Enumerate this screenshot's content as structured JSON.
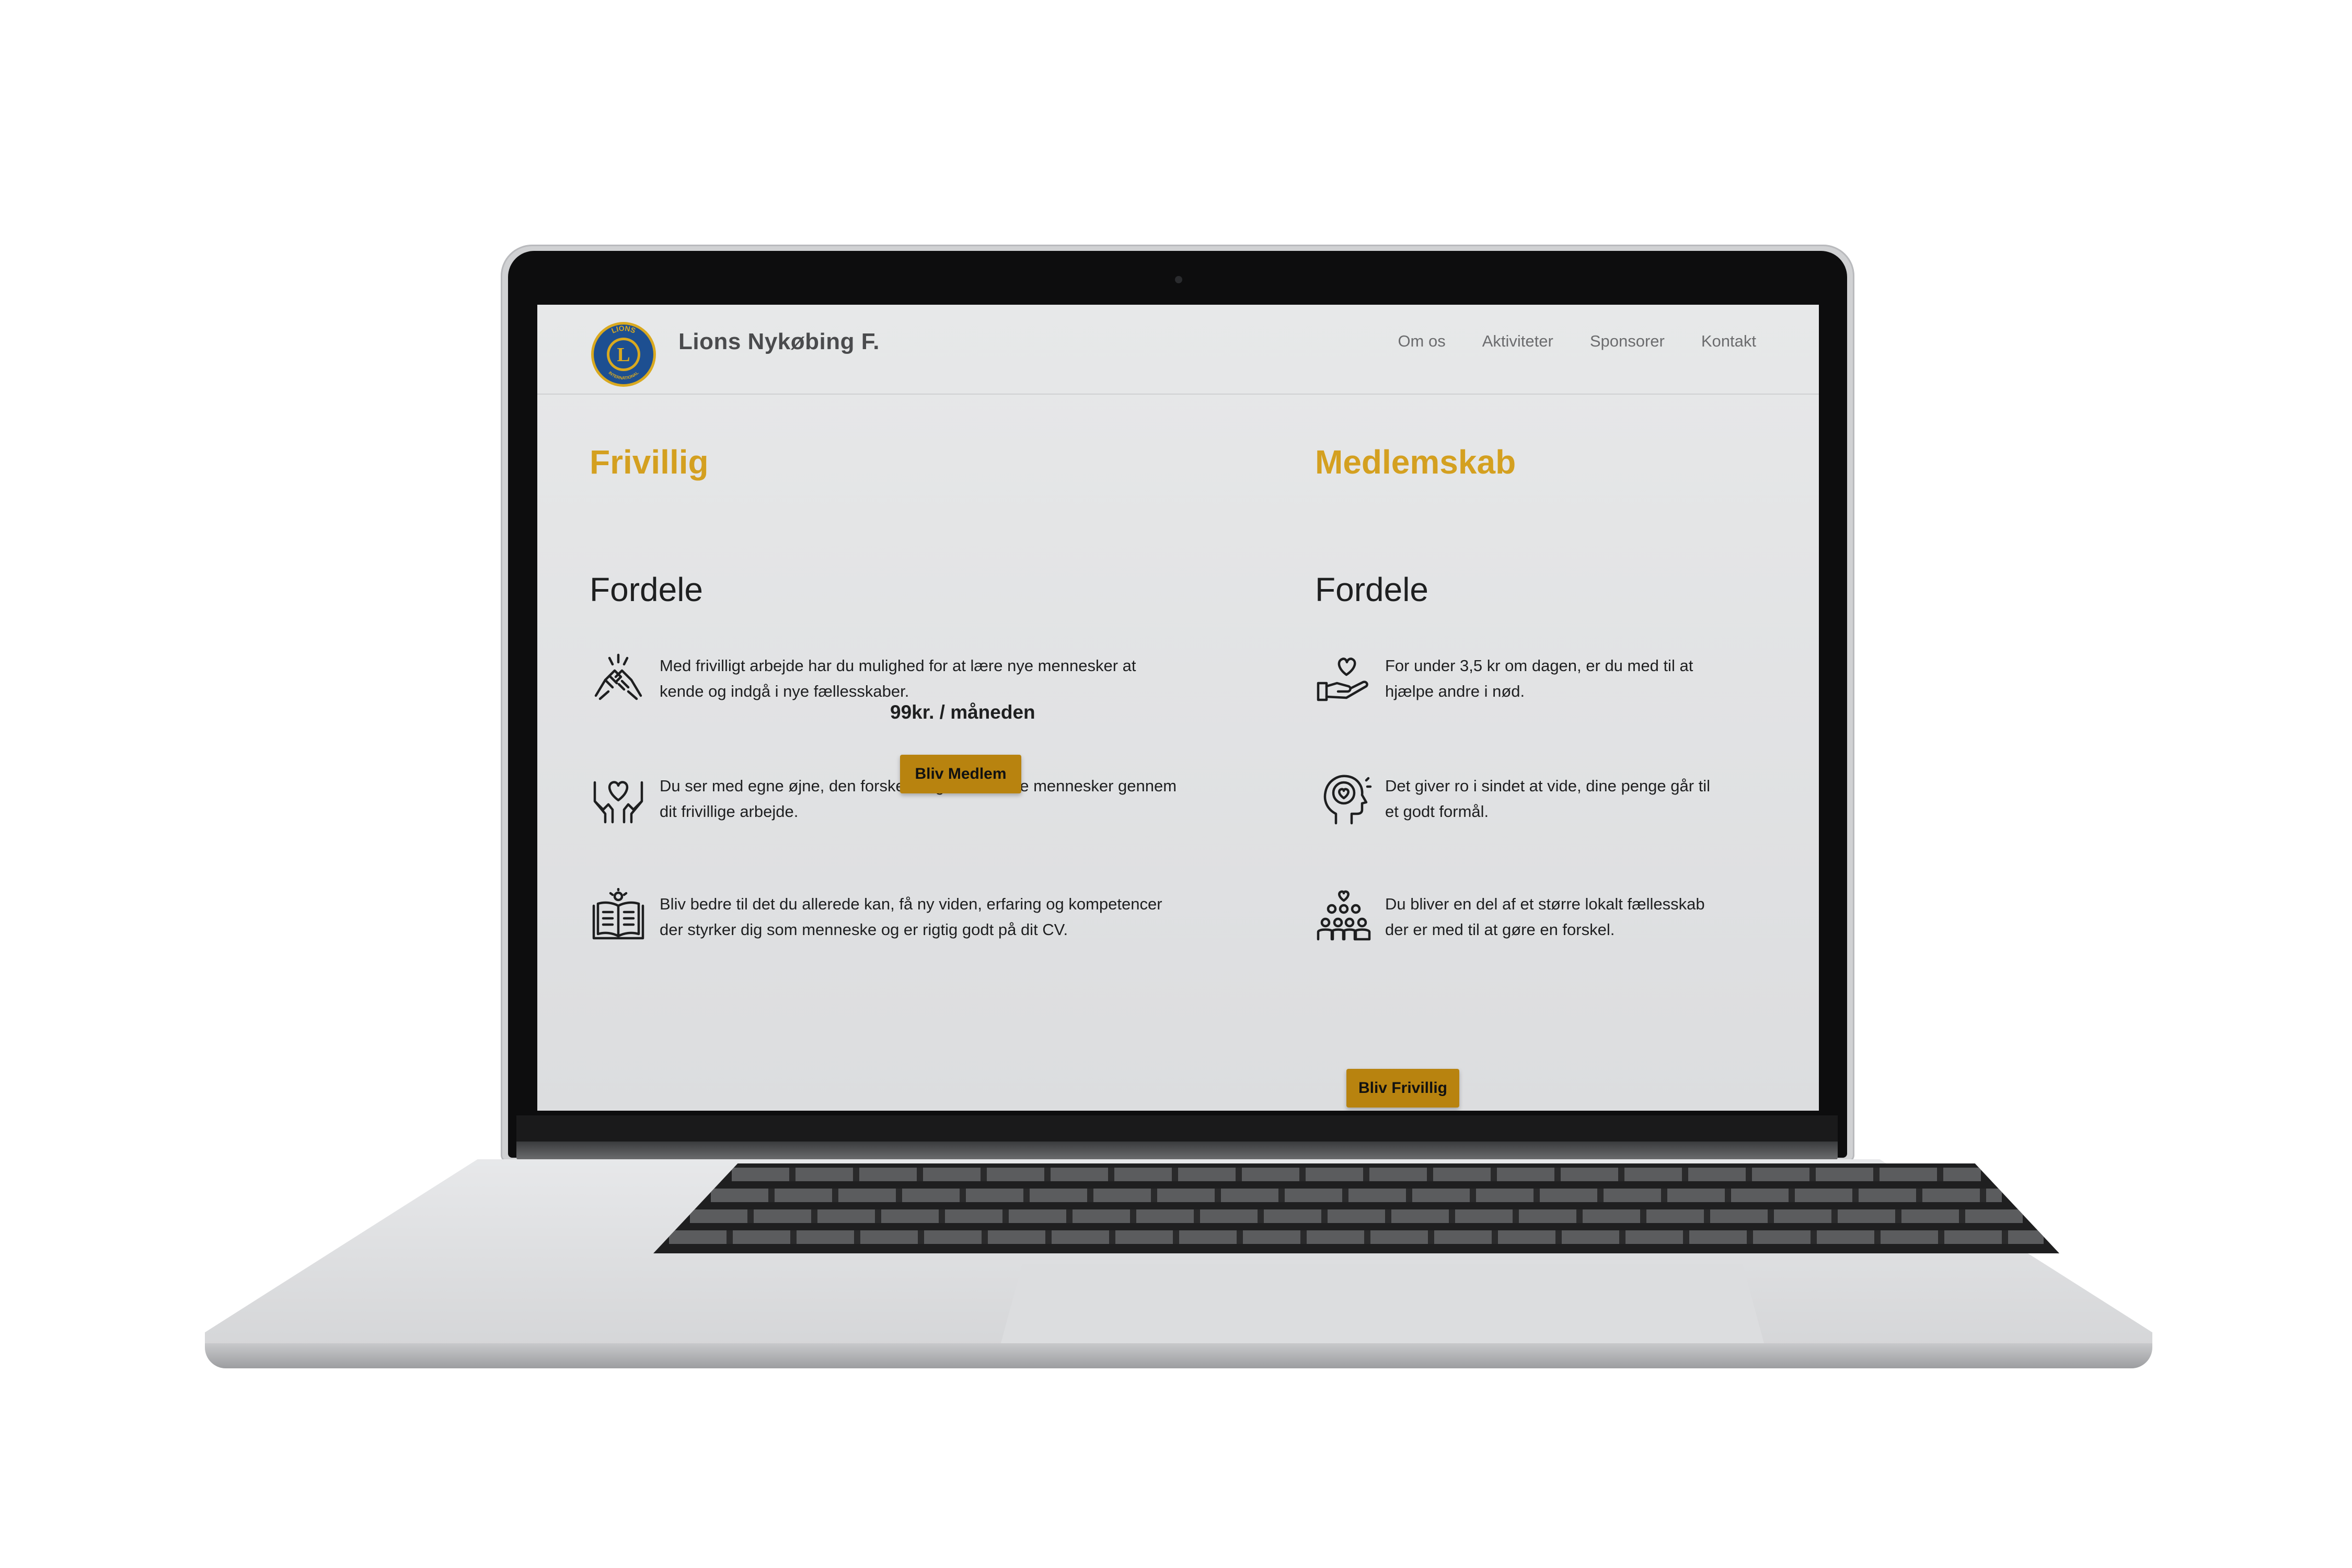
{
  "site": {
    "brand": "Lions Nykøbing F.",
    "logo_text": "LIONS",
    "logo_letter": "L",
    "logo_sub": "INTERNATIONAL",
    "nav": [
      {
        "label": "Om os"
      },
      {
        "label": "Aktiviteter"
      },
      {
        "label": "Sponsorer"
      },
      {
        "label": "Kontakt"
      }
    ]
  },
  "frivillig": {
    "title": "Frivillig",
    "subtitle": "Fordele",
    "items": [
      {
        "icon": "handshake-icon",
        "text": "Med frivilligt arbejde har du mulighed for at lære nye mennesker at kende og indgå i nye fællesskaber."
      },
      {
        "icon": "hands-heart-icon",
        "text": "Du ser med egne øjne, den forskel du gør for andre mennesker gennem dit frivillige arbejde."
      },
      {
        "icon": "book-lightbulb-icon",
        "text": "Bliv bedre til det du allerede kan, få ny viden, erfaring og kompetencer der styrker dig som menneske og er rigtig godt på dit CV."
      }
    ],
    "button": "Bliv Frivillig"
  },
  "medlemskab": {
    "title": "Medlemskab",
    "subtitle": "Fordele",
    "items": [
      {
        "icon": "hand-heart-icon",
        "text": "For under 3,5 kr om dagen, er du med til at hjælpe andre i nød."
      },
      {
        "icon": "head-heart-icon",
        "text": "Det giver ro i sindet at vide, dine penge går til et godt formål."
      },
      {
        "icon": "community-heart-icon",
        "text": "Du bliver en del af et større lokalt fællesskab der er med til at gøre en forskel."
      }
    ],
    "price": "99kr. / måneden",
    "button": "Bliv Medlem"
  },
  "colors": {
    "accent": "#d4a020",
    "button": "#b8830f",
    "text": "#1e1f20",
    "page": "#e2e3e4"
  }
}
